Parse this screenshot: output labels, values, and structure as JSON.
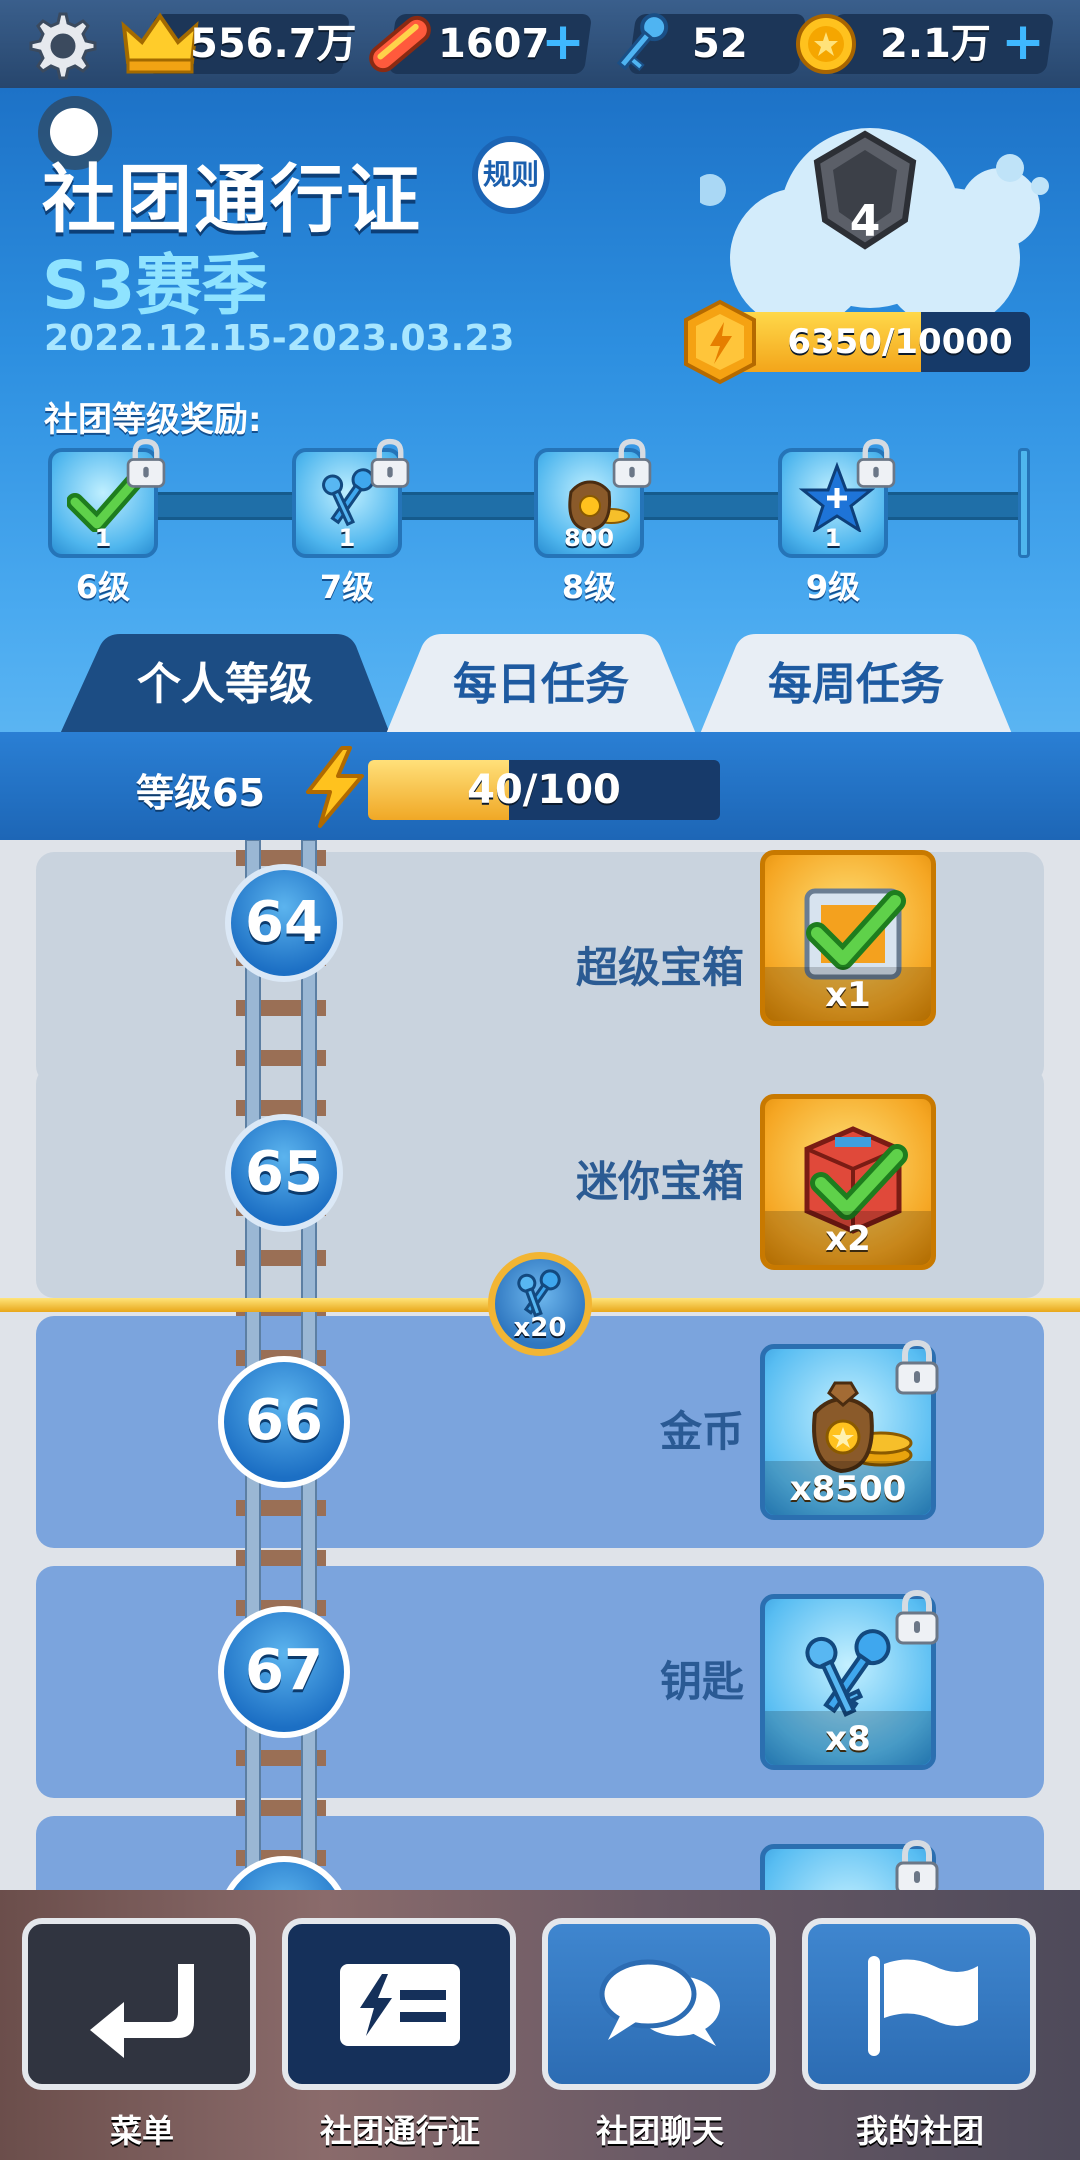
{
  "currencies": {
    "crowns": "556.7万",
    "boards": "1607",
    "keys": "52",
    "coins": "2.1万"
  },
  "header": {
    "title": "社团通行证",
    "rules_label": "规则",
    "season": "S3赛季",
    "dates": "2022.12.15-2023.03.23",
    "club_rank": "4",
    "club_xp_text": "6350/10000",
    "club_xp_progress": 0.635,
    "club_rewards_label": "社团等级奖励:"
  },
  "club_rewards": [
    {
      "level": "6级",
      "count": "1",
      "icon": "checkmark-icon"
    },
    {
      "level": "7级",
      "count": "1",
      "icon": "keys-icon"
    },
    {
      "level": "8级",
      "count": "800",
      "icon": "coin-bag-icon"
    },
    {
      "level": "9级",
      "count": "1",
      "icon": "star-icon"
    }
  ],
  "tabs": [
    {
      "label": "个人等级",
      "active": true
    },
    {
      "label": "每日任务",
      "active": false
    },
    {
      "label": "每周任务",
      "active": false
    }
  ],
  "personal": {
    "level_label": "等级65",
    "progress_text": "40/100",
    "progress": 0.4
  },
  "levels": [
    {
      "num": "64",
      "name": "超级宝箱",
      "count": "x1",
      "claimed": true,
      "tile": "orange",
      "icon": "super-chest-icon"
    },
    {
      "num": "65",
      "name": "迷你宝箱",
      "count": "x2",
      "claimed": true,
      "tile": "orange",
      "icon": "mini-chest-icon"
    },
    {
      "num": "66",
      "name": "金币",
      "count": "x8500",
      "claimed": false,
      "tile": "blue",
      "icon": "coin-bag-icon"
    },
    {
      "num": "67",
      "name": "钥匙",
      "count": "x8",
      "claimed": false,
      "tile": "blue",
      "icon": "keys-icon"
    }
  ],
  "progress_marker": {
    "count": "x20",
    "icon": "keys-icon"
  },
  "nav": [
    {
      "label": "菜单",
      "icon": "return-arrow-icon"
    },
    {
      "label": "社团通行证",
      "icon": "pass-icon"
    },
    {
      "label": "社团聊天",
      "icon": "chat-bubbles-icon"
    },
    {
      "label": "我的社团",
      "icon": "flag-icon"
    }
  ],
  "colors": {
    "primary_blue": "#1d72c7",
    "gold": "#f3a51a",
    "locked_row": "#7ba4dd",
    "claimed_row": "#c9d3de"
  }
}
